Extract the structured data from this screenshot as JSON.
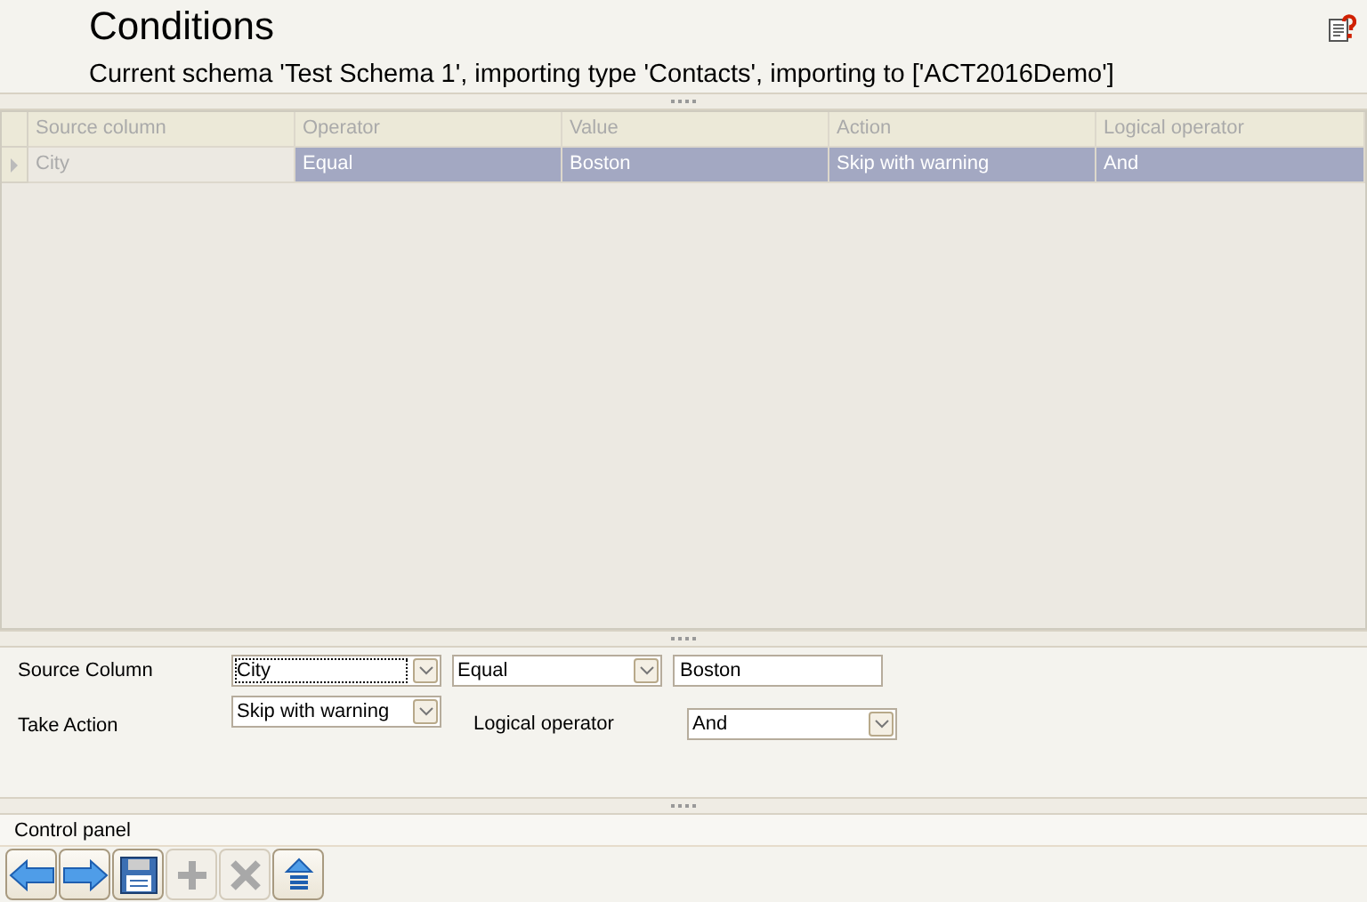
{
  "header": {
    "title": "Conditions",
    "subtitle": "Current schema 'Test Schema 1', importing type 'Contacts', importing to ['ACT2016Demo']"
  },
  "table": {
    "columns": [
      "Source column",
      "Operator",
      "Value",
      "Action",
      "Logical operator"
    ],
    "rows": [
      {
        "selected": true,
        "cells": [
          "City",
          "Equal",
          "Boston",
          "Skip with warning",
          "And"
        ]
      }
    ]
  },
  "form": {
    "source_column": {
      "label": "Source Column",
      "value": "City"
    },
    "operator": {
      "value": "Equal"
    },
    "value": {
      "value": "Boston"
    },
    "take_action": {
      "label": "Take Action",
      "value": "Skip with warning"
    },
    "logical_operator": {
      "label": "Logical operator",
      "value": "And"
    }
  },
  "control_panel": {
    "title": "Control panel",
    "buttons": [
      {
        "kind": "back",
        "disabled": false
      },
      {
        "kind": "forward",
        "disabled": false
      },
      {
        "kind": "save",
        "disabled": false
      },
      {
        "kind": "add",
        "disabled": true
      },
      {
        "kind": "delete",
        "disabled": true
      },
      {
        "kind": "upload",
        "disabled": false
      }
    ]
  }
}
